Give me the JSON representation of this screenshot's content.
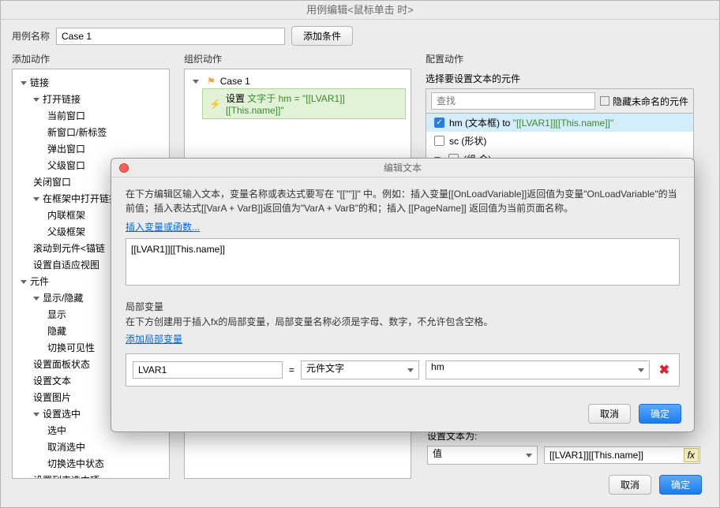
{
  "main": {
    "title": "用例编辑<鼠标单击 时>",
    "caseNameLabel": "用例名称",
    "caseNameValue": "Case 1",
    "addConditionBtn": "添加条件",
    "colHeaders": {
      "add": "添加动作",
      "org": "组织动作",
      "cfg": "配置动作"
    },
    "tree": [
      {
        "t": "链接",
        "l": 0,
        "exp": true
      },
      {
        "t": "打开链接",
        "l": 1,
        "exp": true
      },
      {
        "t": "当前窗口",
        "l": 2
      },
      {
        "t": "新窗口/新标签",
        "l": 2
      },
      {
        "t": "弹出窗口",
        "l": 2
      },
      {
        "t": "父级窗口",
        "l": 2
      },
      {
        "t": "关闭窗口",
        "l": 1
      },
      {
        "t": "在框架中打开链接",
        "l": 1,
        "exp": true,
        "trunc": true
      },
      {
        "t": "内联框架",
        "l": 2
      },
      {
        "t": "父级框架",
        "l": 2
      },
      {
        "t": "滚动到元件<锚链",
        "l": 1,
        "trunc": true
      },
      {
        "t": "设置自适应视图",
        "l": 1
      },
      {
        "t": "元件",
        "l": 0,
        "exp": true
      },
      {
        "t": "显示/隐藏",
        "l": 1,
        "exp": true
      },
      {
        "t": "显示",
        "l": 2
      },
      {
        "t": "隐藏",
        "l": 2
      },
      {
        "t": "切换可见性",
        "l": 2
      },
      {
        "t": "设置面板状态",
        "l": 1
      },
      {
        "t": "设置文本",
        "l": 1
      },
      {
        "t": "设置图片",
        "l": 1
      },
      {
        "t": "设置选中",
        "l": 1,
        "exp": true
      },
      {
        "t": "选中",
        "l": 2
      },
      {
        "t": "取消选中",
        "l": 2
      },
      {
        "t": "切换选中状态",
        "l": 2
      },
      {
        "t": "设置列表选中项",
        "l": 1
      }
    ],
    "org": {
      "caseLabel": "Case 1",
      "actionPrefix": "设置 ",
      "actionMid": "文字于 hm = ",
      "actionExpr": "\"[[LVAR1]][[This.name]]\""
    },
    "cfg": {
      "selectLabel": "选择要设置文本的元件",
      "searchPlaceholder": "查找",
      "hideUnnamed": "隐藏未命名的元件",
      "items": [
        {
          "checked": true,
          "label": "hm (文本框) to ",
          "expr": "\"[[LVAR1]][[This.name]]\""
        },
        {
          "checked": false,
          "label": "sc (形状)"
        },
        {
          "checked": false,
          "label": "(组 合)",
          "exp": true
        }
      ],
      "setTextAsLabel": "设置文本为:",
      "setTextType": "值",
      "setTextValue": "[[LVAR1]][[This.name]]",
      "fxLabel": "fx"
    },
    "cancel": "取消",
    "ok": "确定"
  },
  "modal": {
    "title": "编辑文本",
    "help": "在下方编辑区输入文本，变量名称或表达式要写在 \"[[\"\"]]\" 中。例如：插入变量[[OnLoadVariable]]返回值为变量\"OnLoadVariable\"的当前值；插入表达式[[VarA + VarB]]返回值为\"VarA + VarB\"的和；插入 [[PageName]] 返回值为当前页面名称。",
    "insertLink": "插入变量或函数...",
    "editorValue": "[[LVAR1]][[This.name]]",
    "localVarLabel": "局部变量",
    "localVarHelp": "在下方创建用于插入fx的局部变量，局部变量名称必须是字母、数字，不允许包含空格。",
    "addLocalVarLink": "添加局部变量",
    "varName": "LVAR1",
    "eq": "=",
    "varType": "元件文字",
    "varTarget": "hm",
    "cancel": "取消",
    "ok": "确定"
  }
}
